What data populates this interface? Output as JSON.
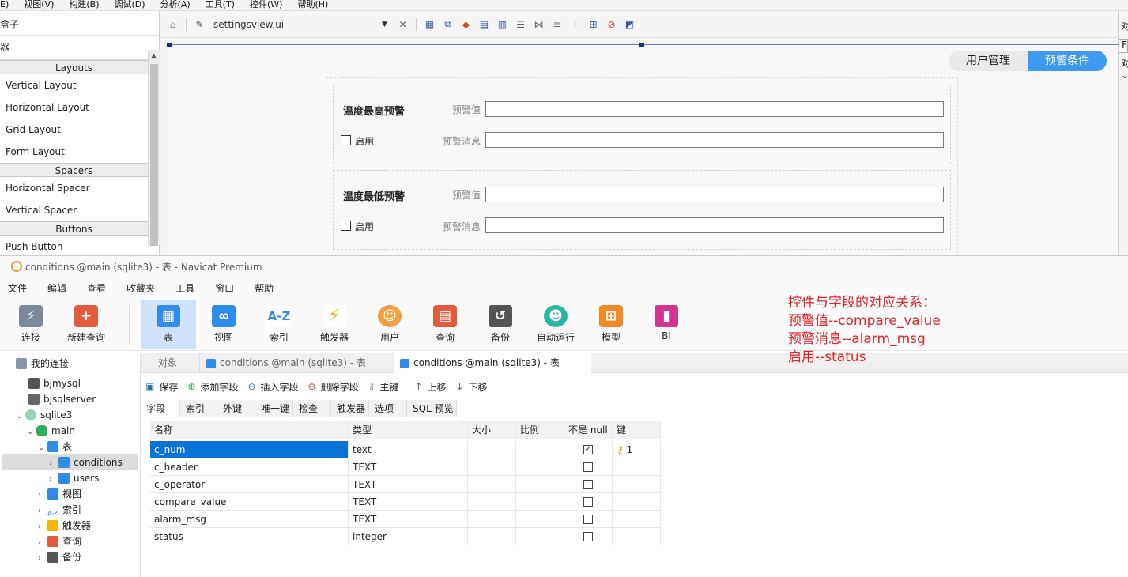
{
  "qt": {
    "menu": [
      "E)",
      "视图(V)",
      "构建(B)",
      "调试(D)",
      "分析(A)",
      "工具(T)",
      "控件(W)",
      "帮助(H)"
    ],
    "widget_box": {
      "title": "盒子",
      "filter": "器",
      "categories": {
        "layouts": "Layouts",
        "spacers": "Spacers",
        "buttons": "Buttons"
      },
      "layouts": [
        "Vertical Layout",
        "Horizontal Layout",
        "Grid Layout",
        "Form Layout"
      ],
      "spacers": [
        "Horizontal Spacer",
        "Vertical Spacer"
      ],
      "buttons": [
        "Push Button"
      ]
    },
    "editor": {
      "file_name": "settingsview.ui",
      "close_glyph": "✕"
    },
    "form": {
      "tabs": [
        "用户管理",
        "预警条件"
      ],
      "active_tab": "预警条件",
      "groups": [
        {
          "title": "温度最高预警",
          "value_label": "预警值",
          "enable_label": "启用",
          "msg_label": "预警消息"
        },
        {
          "title": "温度最低预警",
          "value_label": "预警值",
          "enable_label": "启用",
          "msg_label": "预警消息"
        }
      ]
    },
    "right_panel": [
      "对",
      "F",
      "对",
      "⌄"
    ]
  },
  "navicat": {
    "title": "conditions @main (sqlite3) - 表 - Navicat Premium",
    "menu": [
      "文件",
      "编辑",
      "查看",
      "收藏夹",
      "工具",
      "窗口",
      "帮助"
    ],
    "tools": [
      {
        "label": "连接",
        "icon": "plug-icon",
        "color": "#6b7b8c"
      },
      {
        "label": "新建查询",
        "icon": "new-query-icon",
        "color": "#e45a3c"
      },
      {
        "label": "表",
        "icon": "table-icon",
        "color": "#2f8ce8"
      },
      {
        "label": "视图",
        "icon": "view-icon",
        "color": "#2f8ce8"
      },
      {
        "label": "索引",
        "icon": "index-icon",
        "color": "#2f8ce8"
      },
      {
        "label": "触发器",
        "icon": "trigger-icon",
        "color": "#f5b400"
      },
      {
        "label": "用户",
        "icon": "user-icon",
        "color": "#f0a040"
      },
      {
        "label": "查询",
        "icon": "query-icon",
        "color": "#e45a3c"
      },
      {
        "label": "备份",
        "icon": "backup-icon",
        "color": "#555555"
      },
      {
        "label": "自动运行",
        "icon": "robot-icon",
        "color": "#2bb3a3"
      },
      {
        "label": "模型",
        "icon": "model-icon",
        "color": "#f08a24"
      },
      {
        "label": "BI",
        "icon": "bi-icon",
        "color": "#d4348f"
      }
    ],
    "active_tool": "表",
    "annotation": "控件与字段的对应关系：\n预警值--compare_value\n预警消息--alarm_msg\n启用--status",
    "tree": [
      {
        "label": "我的连接",
        "level": 0,
        "icon": "connections-icon"
      },
      {
        "label": "bjmysql",
        "level": 1,
        "icon": "mysql-icon"
      },
      {
        "label": "bjsqlserver",
        "level": 1,
        "icon": "sqlserver-icon"
      },
      {
        "label": "sqlite3",
        "level": 1,
        "icon": "sqlite-icon",
        "arrow": "v"
      },
      {
        "label": "main",
        "level": 2,
        "icon": "database-icon",
        "arrow": "v"
      },
      {
        "label": "表",
        "level": 3,
        "icon": "table-icon",
        "arrow": "v"
      },
      {
        "label": "conditions",
        "level": 4,
        "icon": "table-icon",
        "arrow": ">",
        "selected": true
      },
      {
        "label": "users",
        "level": 4,
        "icon": "table-icon",
        "arrow": ">"
      },
      {
        "label": "视图",
        "level": 3,
        "icon": "view-icon",
        "arrow": ">"
      },
      {
        "label": "索引",
        "level": 3,
        "icon": "index-icon",
        "arrow": ">"
      },
      {
        "label": "触发器",
        "level": 3,
        "icon": "trigger-icon",
        "arrow": ">"
      },
      {
        "label": "查询",
        "level": 3,
        "icon": "query-icon",
        "arrow": ">"
      },
      {
        "label": "备份",
        "level": 3,
        "icon": "backup-icon",
        "arrow": ">"
      }
    ],
    "tabs": [
      "对象",
      "conditions @main (sqlite3) - 表",
      "conditions @main (sqlite3) - 表"
    ],
    "subtoolbar": [
      "保存",
      "添加字段",
      "插入字段",
      "删除字段",
      "主键",
      "上移",
      "下移"
    ],
    "subtabs": [
      "字段",
      "索引",
      "外键",
      "唯一键",
      "检查",
      "触发器",
      "选项",
      "SQL 预览"
    ],
    "grid": {
      "columns": [
        "名称",
        "类型",
        "大小",
        "比例",
        "不是 null",
        "键"
      ],
      "rows": [
        {
          "name": "c_num",
          "type": "text",
          "size": "",
          "scale": "",
          "not_null": true,
          "key": "1"
        },
        {
          "name": "c_header",
          "type": "TEXT",
          "size": "",
          "scale": "",
          "not_null": false,
          "key": ""
        },
        {
          "name": "c_operator",
          "type": "TEXT",
          "size": "",
          "scale": "",
          "not_null": false,
          "key": ""
        },
        {
          "name": "compare_value",
          "type": "TEXT",
          "size": "",
          "scale": "",
          "not_null": false,
          "key": ""
        },
        {
          "name": "alarm_msg",
          "type": "TEXT",
          "size": "",
          "scale": "",
          "not_null": false,
          "key": ""
        },
        {
          "name": "status",
          "type": "integer",
          "size": "",
          "scale": "",
          "not_null": false,
          "key": ""
        }
      ]
    }
  }
}
